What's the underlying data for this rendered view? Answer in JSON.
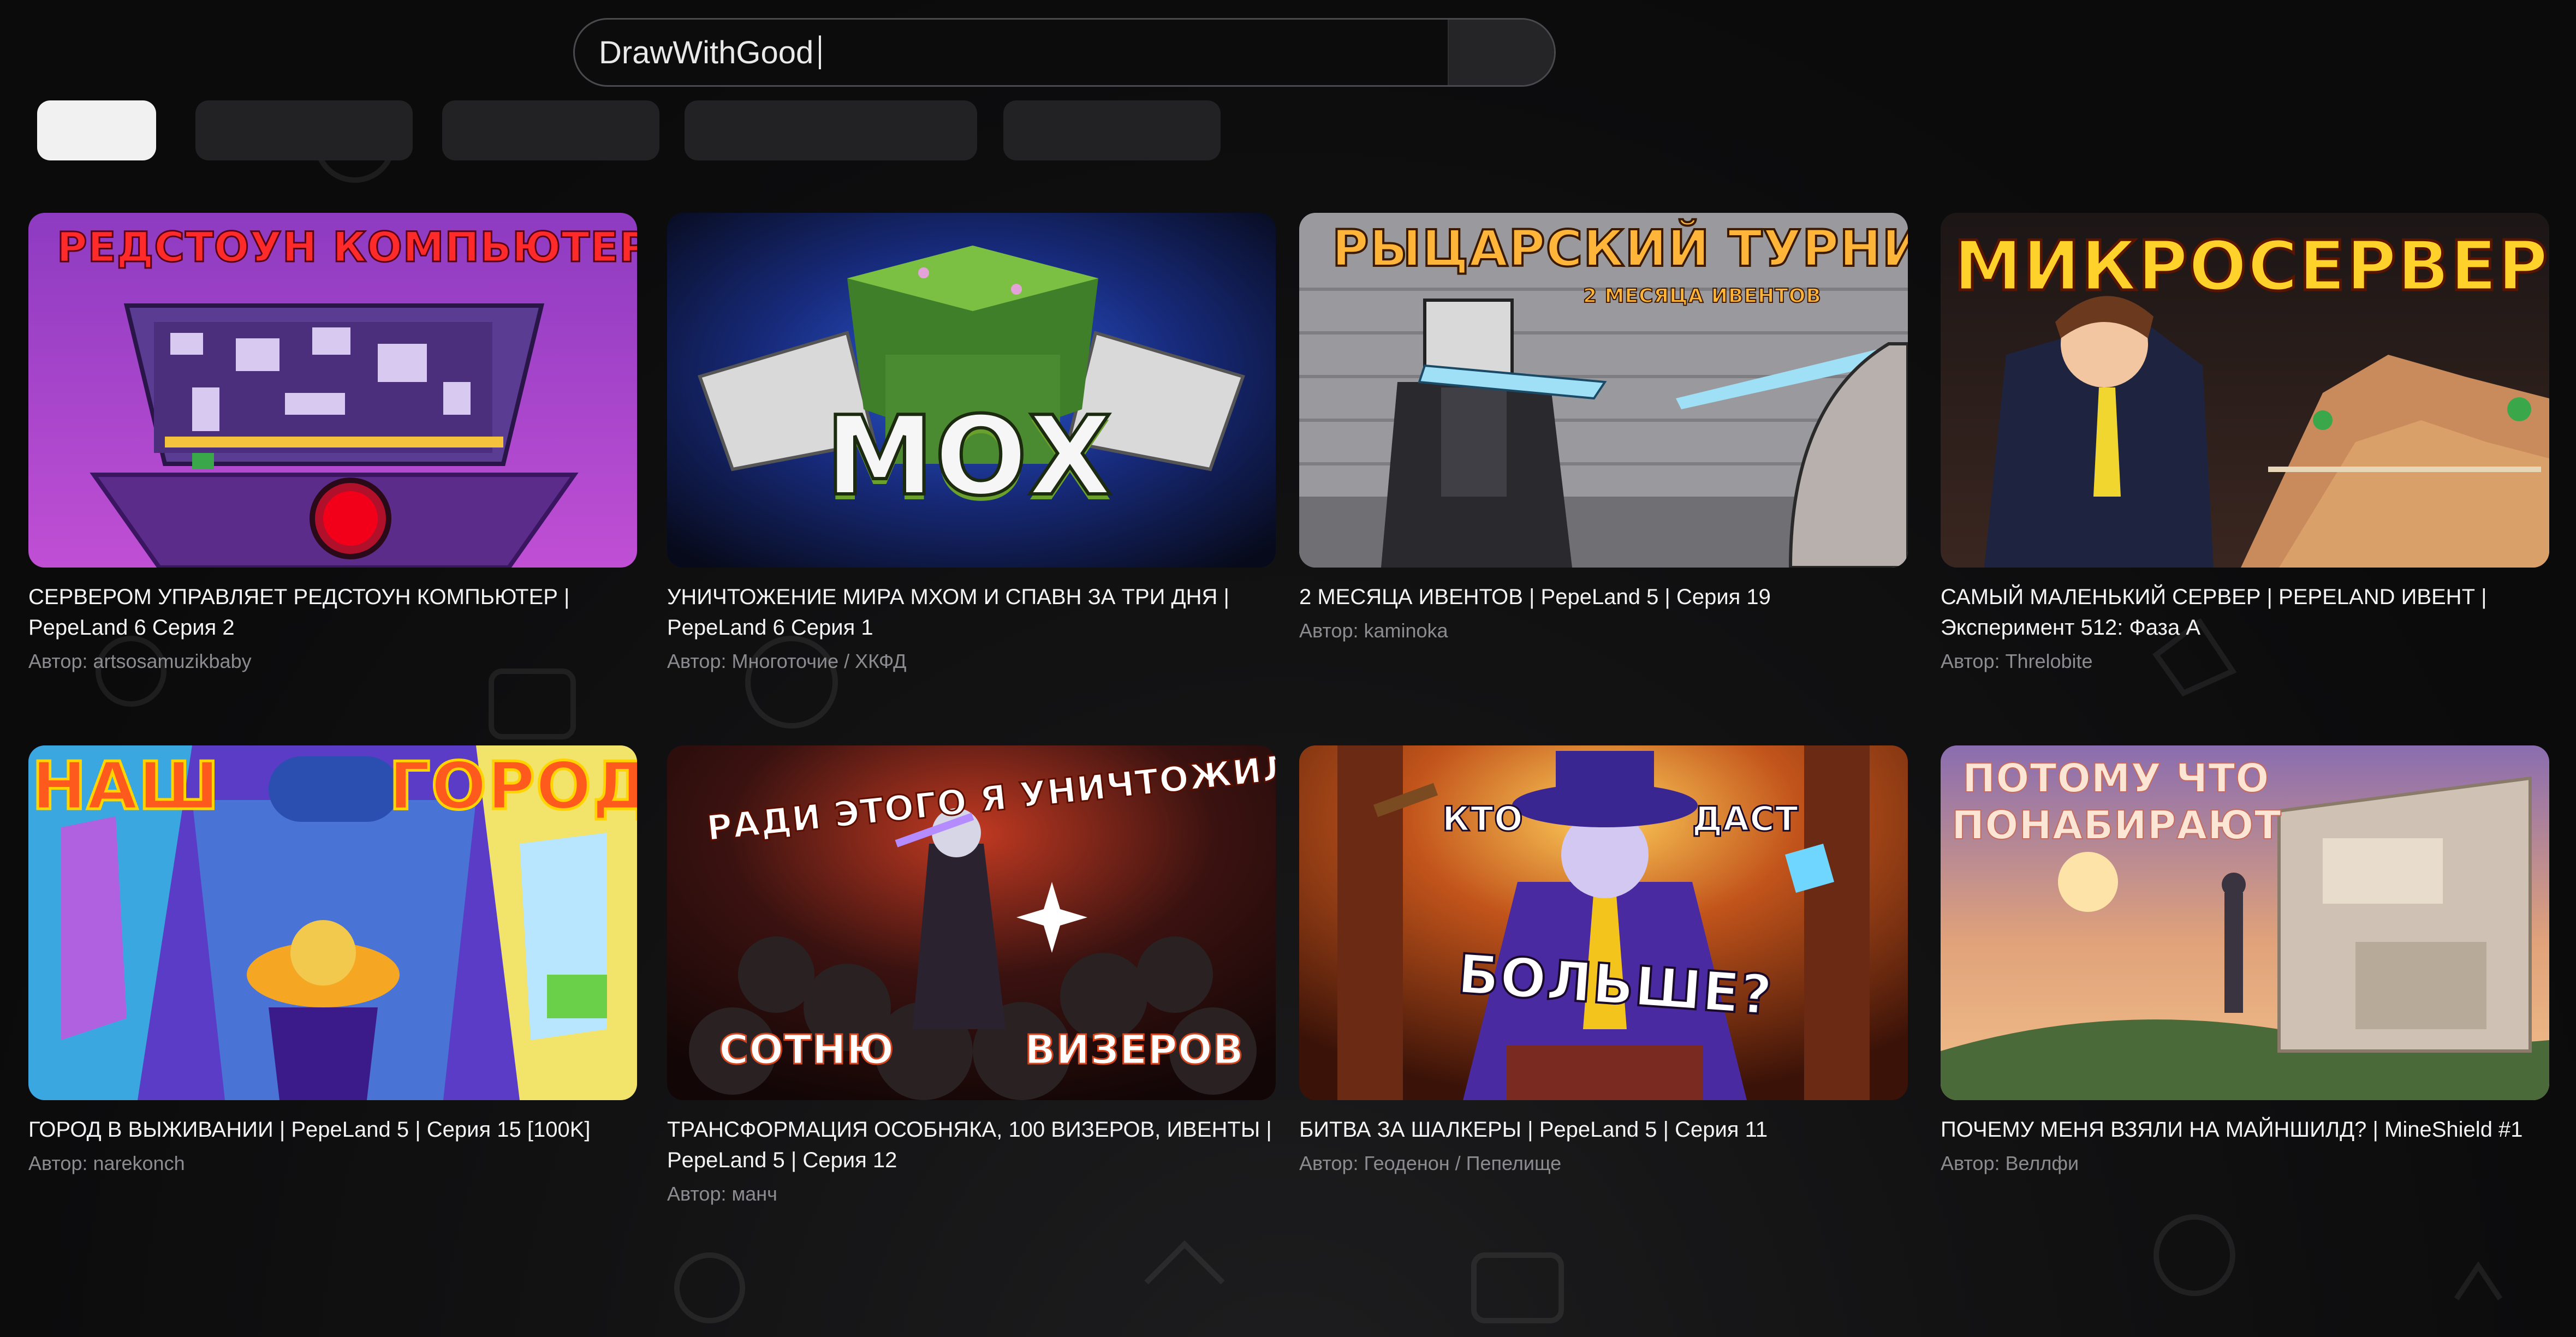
{
  "search": {
    "value": "DrawWithGood"
  },
  "chips": [
    {
      "label": "",
      "active": true
    },
    {
      "label": "",
      "active": false
    },
    {
      "label": "",
      "active": false
    },
    {
      "label": "",
      "active": false
    },
    {
      "label": "",
      "active": false
    }
  ],
  "videos": [
    {
      "title": "СЕРВЕРОМ УПРАВЛЯЕТ РЕДСТОУН КОМПЬЮТЕР | PepeLand 6 Серия 2",
      "author": "Автор: artsosamuzikbaby",
      "thumb_text": [
        "РЕДСТОУН КОМПЬЮТЕР"
      ]
    },
    {
      "title": "УНИЧТОЖЕНИЕ МИРА МХОМ И СПАВН ЗА ТРИ ДНЯ | PepeLand 6 Серия 1",
      "author": "Автор: Многоточие / ХКФД",
      "thumb_text": [
        "МОХ"
      ]
    },
    {
      "title": "2 МЕСЯЦА ИВЕНТОВ | PepeLand 5 | Серия 19",
      "author": "Автор: kaminoka",
      "thumb_text": [
        "РЫЦАРСКИЙ ТУРНИР",
        "2 МЕСЯЦА ИВЕНТОВ"
      ]
    },
    {
      "title": "САМЫЙ МАЛЕНЬКИЙ СЕРВЕР | PEPELAND ИВЕНТ | Эксперимент 512: Фаза А",
      "author": "Автор: Threlobite",
      "thumb_text": [
        "МИКРОСЕРВЕР"
      ]
    },
    {
      "title": "ГОРОД В ВЫЖИВАНИИ | PepeLand 5 | Серия 15 [100K]",
      "author": "Автор: narekonch",
      "thumb_text": [
        "НАШ",
        "ГОРОД"
      ]
    },
    {
      "title": "ТРАНСФОРМАЦИЯ ОСОБНЯКА, 100 ВИЗЕРОВ, ИВЕНТЫ | PepeLand 5 | Серия 12",
      "author": "Автор: манч",
      "thumb_text": [
        "РАДИ ЭТОГО Я УНИЧТОЖИЛ",
        "СОТНЮ",
        "ВИЗЕРОВ"
      ]
    },
    {
      "title": "БИТВА ЗА ШАЛКЕРЫ | PepeLand 5 | Серия 11",
      "author": "Автор: Геоденон / Пепелище",
      "thumb_text": [
        "КТО",
        "ДАСТ",
        "БОЛЬШЕ?"
      ]
    },
    {
      "title": "ПОЧЕМУ МЕНЯ ВЗЯЛИ НА МАЙНШИЛД? | MineShield #1",
      "author": "Автор: Веллфи",
      "thumb_text": [
        "ПОТОМУ ЧТО",
        "ПОНАБИРАЮТ"
      ]
    }
  ]
}
